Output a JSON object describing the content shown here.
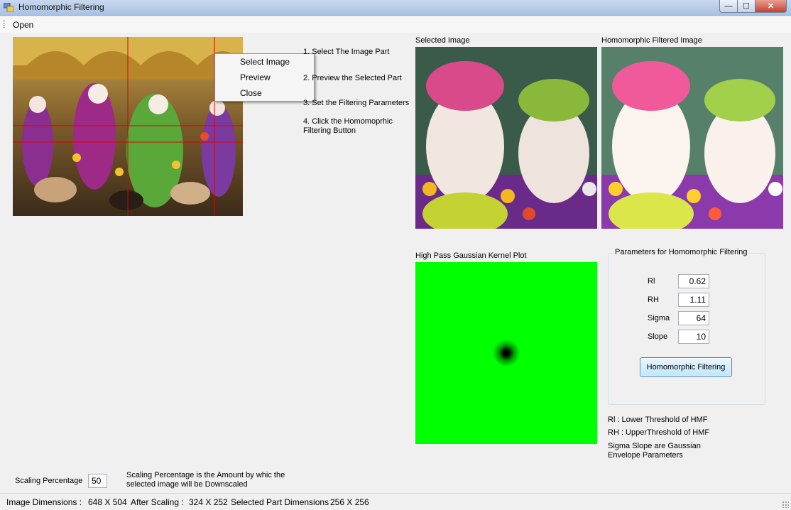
{
  "window": {
    "title": "Homomorphic Filtering",
    "min_glyph": "—",
    "max_glyph": "☐",
    "close_glyph": "✕"
  },
  "menu": {
    "open_label": "Open"
  },
  "context_menu": {
    "items": [
      "Select Image",
      "Preview",
      "Close"
    ]
  },
  "instructions": {
    "step1": "1. Select The Image Part",
    "step2": "2. Preview the Selected Part",
    "step3": "3. Set the Filtering Parameters",
    "step4_line1": "4. Click the Homomoprhic",
    "step4_line2": "Filtering Button"
  },
  "panels": {
    "selected_title": "Selected Image",
    "filtered_title": "Homomorphic Filtered Image",
    "kernel_title": "High Pass Gaussian Kernel Plot"
  },
  "parameters": {
    "group_title": "Parameters for Homomorphic Filtering",
    "rl_label": "Rl",
    "rl_value": "0.62",
    "rh_label": "RH",
    "rh_value": "1.11",
    "sigma_label": "Sigma",
    "sigma_value": "64",
    "slope_label": "Slope",
    "slope_value": "10",
    "button_label": "Homomorphic Filtering"
  },
  "legend": {
    "line1": "Rl : Lower Threshold of HMF",
    "line2": "RH :  UpperThreshold of HMF",
    "line3": "Sigma  Slope are Gaussian",
    "line4": "Envelope Parameters"
  },
  "scaling": {
    "label": "Scaling Percentage",
    "value": "50",
    "note_line1": "Scaling Percentage is the Amount by whic the",
    "note_line2": "selected image will be Downscaled"
  },
  "status": {
    "image_dims_label": "Image Dimensions :",
    "image_dims_value": "648  X 504",
    "after_scaling_label": "After Scaling :",
    "after_scaling_value": "324  X 252",
    "selected_dims_label": "Selected Part Dimensions",
    "selected_dims_value": "256  X 256"
  },
  "colors": {
    "kernel_green": "#00ff00",
    "crosshair": "#e00000",
    "button_border": "#3c7fb1"
  }
}
